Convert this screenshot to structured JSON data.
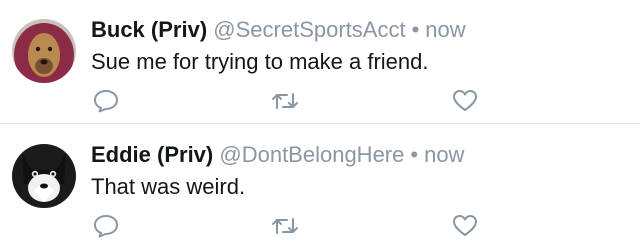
{
  "tweets": [
    {
      "name": "Buck (Priv)",
      "handle": "@SecretSportsAcct",
      "separator": "•",
      "time": "now",
      "text": "Sue me for trying to make a friend.",
      "avatar_icon": "dog-in-hood-avatar"
    },
    {
      "name": "Eddie (Priv)",
      "handle": "@DontBelongHere",
      "separator": "•",
      "time": "now",
      "text": "That was weird.",
      "avatar_icon": "tuxedo-cat-avatar"
    }
  ],
  "icons": {
    "reply": "reply-icon",
    "retweet": "retweet-icon",
    "like": "heart-icon"
  },
  "colors": {
    "name_text": "#14171a",
    "meta_text": "#8a97a2",
    "icon_stroke": "#8a97a2",
    "divider": "#dfe3e6"
  }
}
